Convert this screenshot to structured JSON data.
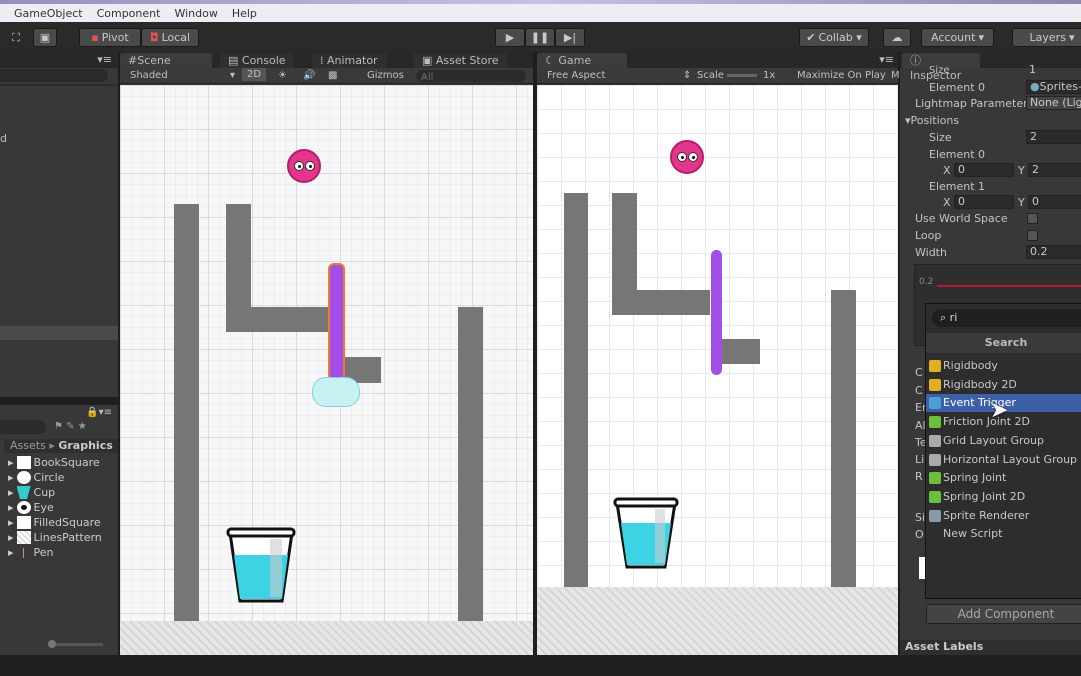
{
  "menu": [
    "GameObject",
    "Component",
    "Window",
    "Help"
  ],
  "toolbar": {
    "pivot": "Pivot",
    "local": "Local",
    "collab": "Collab ▾",
    "account": "Account",
    "layers": "Layers"
  },
  "scene": {
    "tabs": [
      "Scene",
      "Console",
      "Animator",
      "Asset Store"
    ],
    "shading": "Shaded",
    "mode_2d": "2D",
    "gizmos": "Gizmos",
    "search_placeholder": "All"
  },
  "game": {
    "tab": "Game",
    "aspect": "Free Aspect",
    "scale_label": "Scale",
    "scale_value": "1x",
    "maximize": "Maximize On Play",
    "more": "M"
  },
  "project": {
    "breadcrumb_root": "Assets",
    "breadcrumb_current": "Graphics",
    "assets": [
      "BookSquare",
      "Circle",
      "Cup",
      "Eye",
      "FilledSquare",
      "LinesPattern",
      "Pen"
    ]
  },
  "hierarchy": {
    "partial_label": "d"
  },
  "inspector": {
    "tab": "Inspector",
    "rows": [
      {
        "label": "Size",
        "value": "1"
      },
      {
        "label": "Element 0",
        "value": "Sprites-"
      },
      {
        "label": "Lightmap Parameter",
        "value": "None (Lig"
      },
      {
        "label": "Positions",
        "value": ""
      },
      {
        "label": "Size",
        "value": "2"
      },
      {
        "label": "Element 0",
        "value": ""
      },
      {
        "label": "Element 1",
        "value": ""
      },
      {
        "label": "Use World Space",
        "value": ""
      },
      {
        "label": "Loop",
        "value": ""
      },
      {
        "label": "Width",
        "value": "0.2"
      }
    ],
    "el0": {
      "x": "0",
      "y": "2"
    },
    "el1": {
      "x": "0",
      "y": "0"
    },
    "curve_label": "0.2",
    "partial_labels": [
      "C",
      "C",
      "Er",
      "Al",
      "Te",
      "Li",
      "R",
      "Si",
      "O"
    ],
    "add_component": "Add Component",
    "asset_labels": "Asset Labels"
  },
  "component_popup": {
    "search_value": "ri",
    "header": "Search",
    "items": [
      {
        "label": "Rigidbody",
        "icon": "rigidbody-icon",
        "color": "#e0b020"
      },
      {
        "label": "Rigidbody 2D",
        "icon": "rigidbody2d-icon",
        "color": "#e0b020"
      },
      {
        "label": "Event Trigger",
        "icon": "event-trigger-icon",
        "color": "#4aa0d0",
        "selected": true
      },
      {
        "label": "Friction Joint 2D",
        "icon": "friction-joint-icon",
        "color": "#6cbf3a"
      },
      {
        "label": "Grid Layout Group",
        "icon": "grid-layout-icon",
        "color": "#aaaaaa"
      },
      {
        "label": "Horizontal Layout Group",
        "icon": "horizontal-layout-icon",
        "color": "#aaaaaa"
      },
      {
        "label": "Spring Joint",
        "icon": "spring-joint-icon",
        "color": "#6cbf3a"
      },
      {
        "label": "Spring Joint 2D",
        "icon": "spring-joint-2d-icon",
        "color": "#6cbf3a"
      },
      {
        "label": "Sprite Renderer",
        "icon": "sprite-renderer-icon",
        "color": "#8899aa"
      },
      {
        "label": "New Script",
        "icon": "",
        "color": ""
      }
    ],
    "selected_color": "#3d5fa8"
  }
}
